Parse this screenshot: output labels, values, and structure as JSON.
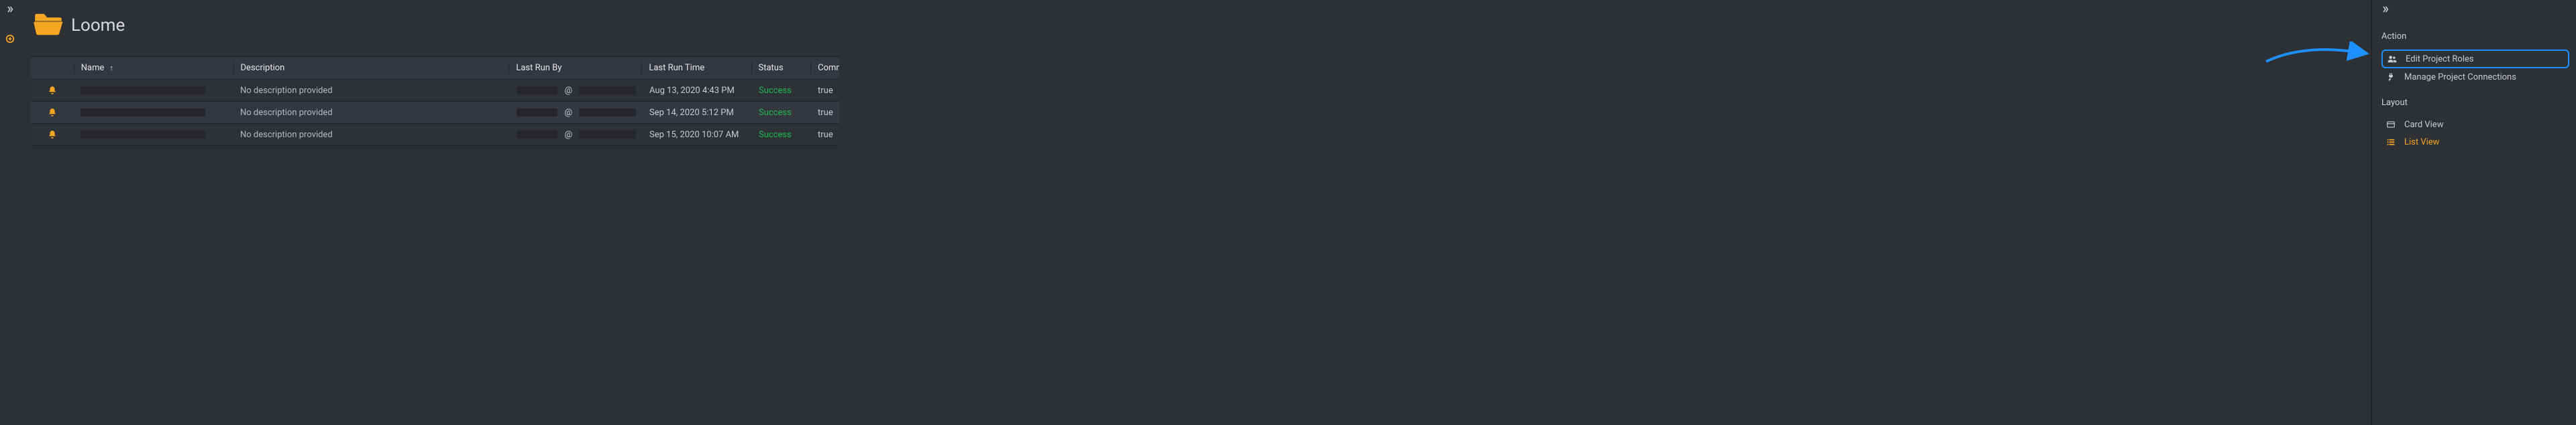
{
  "brand": {
    "name": "Loome"
  },
  "table": {
    "headers": {
      "name": "Name",
      "description": "Description",
      "last_run_by": "Last Run By",
      "last_run_time": "Last Run Time",
      "status": "Status",
      "comm": "Comm"
    },
    "sort": {
      "column": "name",
      "direction": "asc",
      "glyph": "↑"
    },
    "rows": [
      {
        "description": "No description provided",
        "at": "@",
        "last_run_time": "Aug 13, 2020 4:43 PM",
        "status": "Success",
        "comm": "true"
      },
      {
        "description": "No description provided",
        "at": "@",
        "last_run_time": "Sep 14, 2020 5:12 PM",
        "status": "Success",
        "comm": "true"
      },
      {
        "description": "No description provided",
        "at": "@",
        "last_run_time": "Sep 15, 2020 10:07 AM",
        "status": "Success",
        "comm": "true"
      }
    ]
  },
  "right_panel": {
    "sections": {
      "action": {
        "title": "Action",
        "items": [
          {
            "label": "Edit Project Roles",
            "icon": "users-icon",
            "highlight": true
          },
          {
            "label": "Manage Project Connections",
            "icon": "plug-icon"
          }
        ]
      },
      "layout": {
        "title": "Layout",
        "items": [
          {
            "label": "Card View",
            "icon": "card-icon"
          },
          {
            "label": "List View",
            "icon": "list-icon",
            "active": true
          }
        ]
      }
    }
  },
  "colors": {
    "accent": "#f5a623",
    "success": "#1db954",
    "callout": "#1e90ff"
  }
}
